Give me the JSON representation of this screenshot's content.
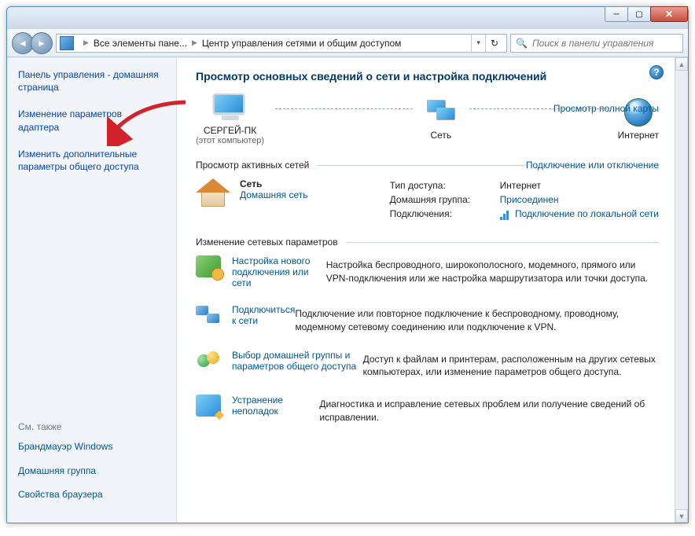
{
  "toolbar": {
    "breadcrumb_root": "Все элементы пане...",
    "breadcrumb_current": "Центр управления сетями и общим доступом",
    "search_placeholder": "Поиск в панели управления"
  },
  "sidebar": {
    "home": "Панель управления - домашняя страница",
    "links": [
      "Изменение параметров адаптера",
      "Изменить дополнительные параметры общего доступа"
    ],
    "see_also_heading": "См. также",
    "see_also": [
      "Брандмауэр Windows",
      "Домашняя группа",
      "Свойства браузера"
    ]
  },
  "main": {
    "title": "Просмотр основных сведений о сети и настройка подключений",
    "full_map_link": "Просмотр полной карты",
    "nodes": {
      "computer": "СЕРГЕЙ-ПК",
      "computer_sub": "(этот компьютер)",
      "network": "Сеть",
      "internet": "Интернет"
    },
    "active_header": "Просмотр активных сетей",
    "connect_disconnect": "Подключение или отключение",
    "active": {
      "name": "Сеть",
      "type": "Домашняя сеть",
      "rows": {
        "access_lbl": "Тип доступа:",
        "access_val": "Интернет",
        "home_lbl": "Домашняя группа:",
        "home_val": "Присоединен",
        "conn_lbl": "Подключения:",
        "conn_val": "Подключение по локальной сети"
      }
    },
    "change_header": "Изменение сетевых параметров",
    "options": [
      {
        "title": "Настройка нового подключения или сети",
        "desc": "Настройка беспроводного, широкополосного, модемного, прямого или VPN-подключения или же настройка маршрутизатора или точки доступа."
      },
      {
        "title": "Подключиться к сети",
        "desc": "Подключение или повторное подключение к беспроводному, проводному, модемному сетевому соединению или подключение к VPN."
      },
      {
        "title": "Выбор домашней группы и параметров общего доступа",
        "desc": "Доступ к файлам и принтерам, расположенным на других сетевых компьютерах, или изменение параметров общего доступа."
      },
      {
        "title": "Устранение неполадок",
        "desc": "Диагностика и исправление сетевых проблем или получение сведений об исправлении."
      }
    ]
  }
}
